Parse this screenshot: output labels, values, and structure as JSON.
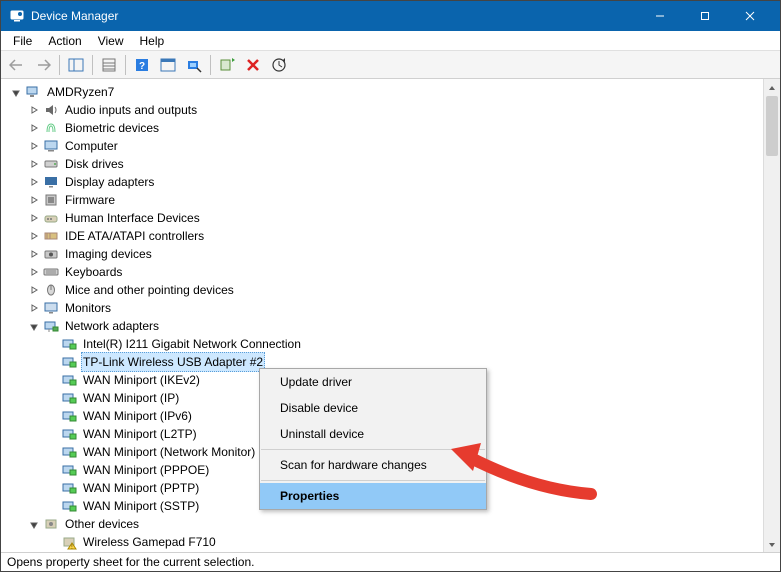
{
  "window": {
    "title": "Device Manager"
  },
  "menubar": [
    "File",
    "Action",
    "View",
    "Help"
  ],
  "tree": {
    "root": "AMDRyzen7",
    "categories": [
      {
        "label": "Audio inputs and outputs",
        "icon": "audio",
        "expanded": false
      },
      {
        "label": "Biometric devices",
        "icon": "biometric",
        "expanded": false
      },
      {
        "label": "Computer",
        "icon": "computer",
        "expanded": false
      },
      {
        "label": "Disk drives",
        "icon": "disk",
        "expanded": false
      },
      {
        "label": "Display adapters",
        "icon": "display",
        "expanded": false
      },
      {
        "label": "Firmware",
        "icon": "firmware",
        "expanded": false
      },
      {
        "label": "Human Interface Devices",
        "icon": "hid",
        "expanded": false
      },
      {
        "label": "IDE ATA/ATAPI controllers",
        "icon": "ide",
        "expanded": false
      },
      {
        "label": "Imaging devices",
        "icon": "imaging",
        "expanded": false
      },
      {
        "label": "Keyboards",
        "icon": "keyboard",
        "expanded": false
      },
      {
        "label": "Mice and other pointing devices",
        "icon": "mouse",
        "expanded": false
      },
      {
        "label": "Monitors",
        "icon": "monitor",
        "expanded": false
      },
      {
        "label": "Network adapters",
        "icon": "network",
        "expanded": true,
        "children": [
          {
            "label": "Intel(R) I211 Gigabit Network Connection",
            "selected": false
          },
          {
            "label": "TP-Link Wireless USB Adapter #2",
            "selected": true
          },
          {
            "label": "WAN Miniport (IKEv2)",
            "selected": false
          },
          {
            "label": "WAN Miniport (IP)",
            "selected": false
          },
          {
            "label": "WAN Miniport (IPv6)",
            "selected": false
          },
          {
            "label": "WAN Miniport (L2TP)",
            "selected": false
          },
          {
            "label": "WAN Miniport (Network Monitor)",
            "selected": false
          },
          {
            "label": "WAN Miniport (PPPOE)",
            "selected": false
          },
          {
            "label": "WAN Miniport (PPTP)",
            "selected": false
          },
          {
            "label": "WAN Miniport (SSTP)",
            "selected": false
          }
        ]
      },
      {
        "label": "Other devices",
        "icon": "other",
        "expanded": true,
        "children": [
          {
            "label": "Wireless Gamepad F710",
            "selected": false,
            "warning": true
          }
        ]
      }
    ]
  },
  "context_menu": {
    "items": [
      {
        "label": "Update driver"
      },
      {
        "label": "Disable device"
      },
      {
        "label": "Uninstall device"
      },
      {
        "divider": true
      },
      {
        "label": "Scan for hardware changes"
      },
      {
        "divider": true
      },
      {
        "label": "Properties",
        "highlight": true
      }
    ]
  },
  "statusbar": "Opens property sheet for the current selection."
}
